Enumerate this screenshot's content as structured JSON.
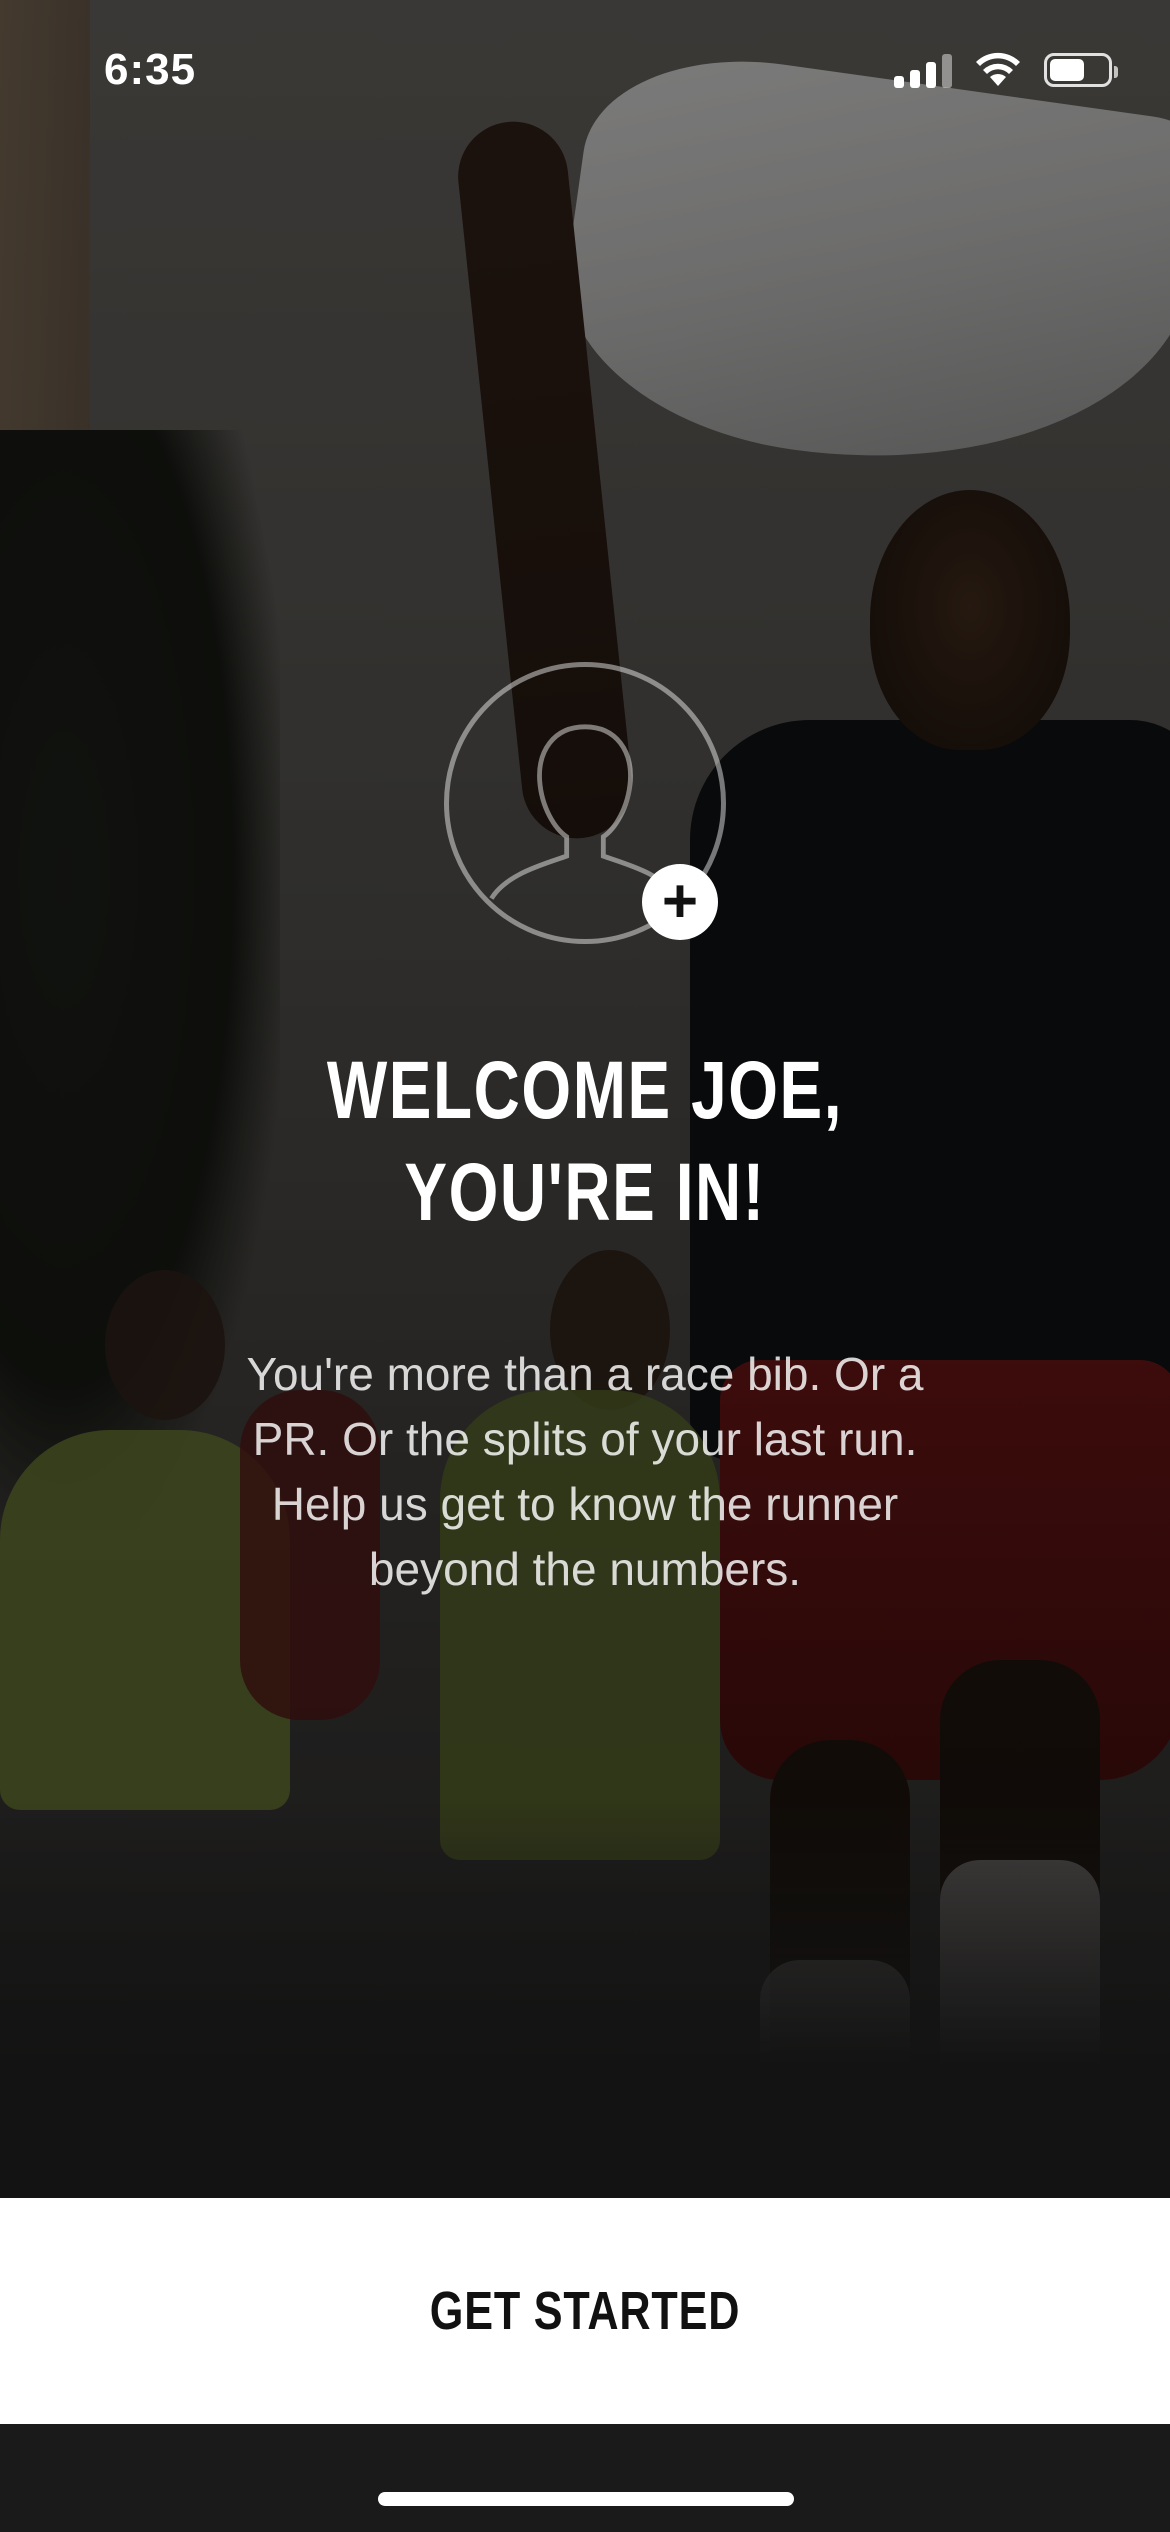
{
  "status_bar": {
    "time": "6:35",
    "signal_icon": "cellular-signal-icon",
    "wifi_icon": "wifi-icon",
    "battery_icon": "battery-icon",
    "battery_level": 0.6
  },
  "avatar": {
    "icon": "user-placeholder-icon",
    "add_icon": "plus-icon",
    "add_symbol": "+"
  },
  "welcome": {
    "line1": "WELCOME JOE,",
    "line2": "YOU'RE IN!"
  },
  "description": "You're more than a race bib. Or a PR. Or the splits of your last run. Help us get to know the runner beyond the numbers.",
  "cta": {
    "label": "GET STARTED",
    "background": "#ffffff",
    "text_color": "#111111"
  }
}
